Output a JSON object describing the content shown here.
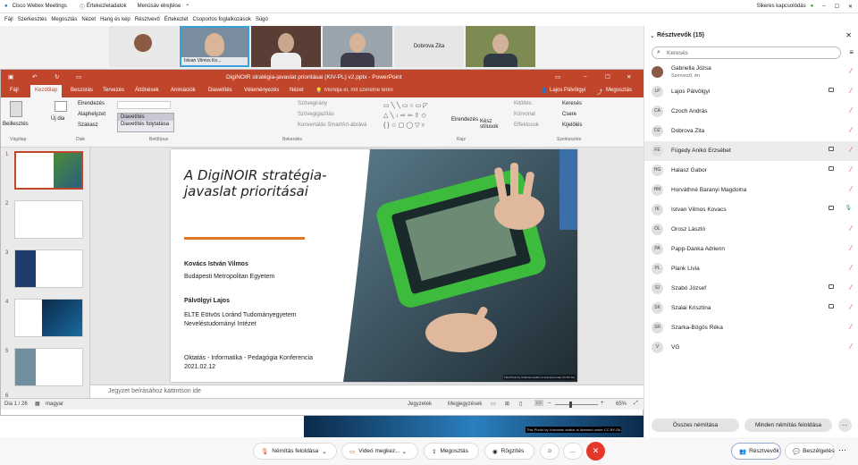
{
  "webex": {
    "app_title": "Cisco Webex Meetings",
    "meeting_info": "Értekezletadatok",
    "hide_menu": "Menüsáv elrejtése",
    "connection_status": "Sikeres kapcsolódás",
    "menu": [
      "Fájl",
      "Szerkesztés",
      "Megosztás",
      "Nézet",
      "Hang és kép",
      "Résztvevő",
      "Értekezlet",
      "Csoportos foglalkozások",
      "Súgó"
    ]
  },
  "video_strip": {
    "tiles": [
      {
        "name": ""
      },
      {
        "name": "Istvan Vilmos Ko..."
      },
      {
        "name": ""
      },
      {
        "name": ""
      },
      {
        "name": "Dobrova Zita"
      },
      {
        "name": ""
      }
    ]
  },
  "ppt": {
    "title": "DigiNOIR stratégia-javaslat prioritásai (KIV-PL) v2.pptx - PowerPoint",
    "user": "Lajos Pálvölgyi",
    "share": "Megosztás",
    "tell_me": "Mondja el, mit szeretne tenni",
    "tabs": [
      "Fájl",
      "Kezdőlap",
      "Beszúrás",
      "Tervezés",
      "Áttűnések",
      "Animációk",
      "Diavetítés",
      "Véleményezés",
      "Nézet"
    ],
    "ribbon": {
      "paste": "Beillesztés",
      "clipboard": "Vágólap",
      "new_slide": "Új dia",
      "layout": "Elrendezés",
      "reset": "Alaphelyzet",
      "section": "Szakasz",
      "slides_group": "Diák",
      "font_group": "Betűtípus",
      "font_dropdown": [
        "Diavetítés",
        "Diavetítés folytatása"
      ],
      "paragraph_group": "Bekezdés",
      "text_direction": "Szövegirány",
      "align_text": "Szövegigazítás",
      "convert_smartart": "Konvertálás SmartArt-ábrává",
      "arrange": "Elrendezés",
      "quick_styles": "Kész stílusok",
      "fill": "Kitöltés",
      "outline": "Körvonal",
      "effects": "Effektusok",
      "drawing_group": "Rajz",
      "find": "Keresés",
      "replace": "Csere",
      "select": "Kijelölés",
      "editing_group": "Szerkesztés"
    },
    "slide_numbers": [
      "1",
      "2",
      "3",
      "4",
      "5",
      "6"
    ],
    "slide": {
      "title": "A DigiNOIR stratégia-javaslat prioritásai",
      "author1_name": "Kovács István Vilmos",
      "author1_org": "Budapesti Metropolitan Egyetem",
      "author2_name": "Pálvölgyi Lajos",
      "author2_org1": "ELTE Eötvös Loránd Tudományegyetem",
      "author2_org2": "Neveléstudományi Intézet",
      "conf_name": "Oktatás - Informatika - Pedagógia Konferencia",
      "conf_date": "2021.02.12",
      "photo_credit": "This Photo by Unknown author is licensed under CC BY-SA"
    },
    "notes_placeholder": "Jegyzet beírásához kattintson ide",
    "status": {
      "slide_count": "Dia 1 / 26",
      "language": "magyar",
      "notes": "Jegyzetek",
      "comments": "Megjegyzések",
      "zoom": "65%"
    }
  },
  "panel": {
    "header": "Résztvevők (15)",
    "search_placeholder": "Keresés",
    "participants": [
      {
        "initials": "",
        "name": "Gabriella Józsa",
        "sub": "Szervező, én",
        "camera": false,
        "mic": "muted"
      },
      {
        "initials": "LP",
        "name": "Lajos Pálvölgyi",
        "sub": "",
        "camera": true,
        "mic": "muted"
      },
      {
        "initials": "CA",
        "name": "Czoch András",
        "sub": "",
        "camera": false,
        "mic": "muted"
      },
      {
        "initials": "DZ",
        "name": "Dobrova Zita",
        "sub": "",
        "camera": false,
        "mic": "muted"
      },
      {
        "initials": "FE",
        "name": "Fügedy Anikó Erzsébet",
        "sub": "",
        "camera": true,
        "mic": "muted"
      },
      {
        "initials": "HG",
        "name": "Halasz Gabor",
        "sub": "",
        "camera": true,
        "mic": "muted"
      },
      {
        "initials": "HM",
        "name": "Horváthné Baranyi Magdolna",
        "sub": "",
        "camera": false,
        "mic": "muted"
      },
      {
        "initials": "IK",
        "name": "Istvan Vilmos Kovacs",
        "sub": "",
        "camera": true,
        "mic": "active"
      },
      {
        "initials": "OL",
        "name": "Orosz László",
        "sub": "",
        "camera": false,
        "mic": "muted"
      },
      {
        "initials": "PA",
        "name": "Papp-Danka Adrienn",
        "sub": "",
        "camera": false,
        "mic": "muted"
      },
      {
        "initials": "PL",
        "name": "Plank Lívia",
        "sub": "",
        "camera": false,
        "mic": "muted"
      },
      {
        "initials": "SJ",
        "name": "Szabó József",
        "sub": "",
        "camera": true,
        "mic": "muted"
      },
      {
        "initials": "SK",
        "name": "Szalai Krisztina",
        "sub": "",
        "camera": true,
        "mic": "muted"
      },
      {
        "initials": "SR",
        "name": "Szarka-Bögös Réka",
        "sub": "",
        "camera": false,
        "mic": "muted"
      },
      {
        "initials": "V",
        "name": "VG",
        "sub": "",
        "camera": false,
        "mic": "muted"
      }
    ],
    "mute_all": "Összes némítása",
    "unmute_all": "Minden némítás feloldása",
    "more": "…"
  },
  "controls": {
    "unmute": "Némítás feloldása",
    "stop_video": "Videó megkez...",
    "share": "Megosztás",
    "record": "Rögzítés",
    "participants": "Résztvevők",
    "chat": "Beszélgetés"
  },
  "colors": {
    "ppt_accent": "#c0452b",
    "mute_red": "#d4452b",
    "end_red": "#e4372a",
    "slide_orange": "#e0782b"
  }
}
